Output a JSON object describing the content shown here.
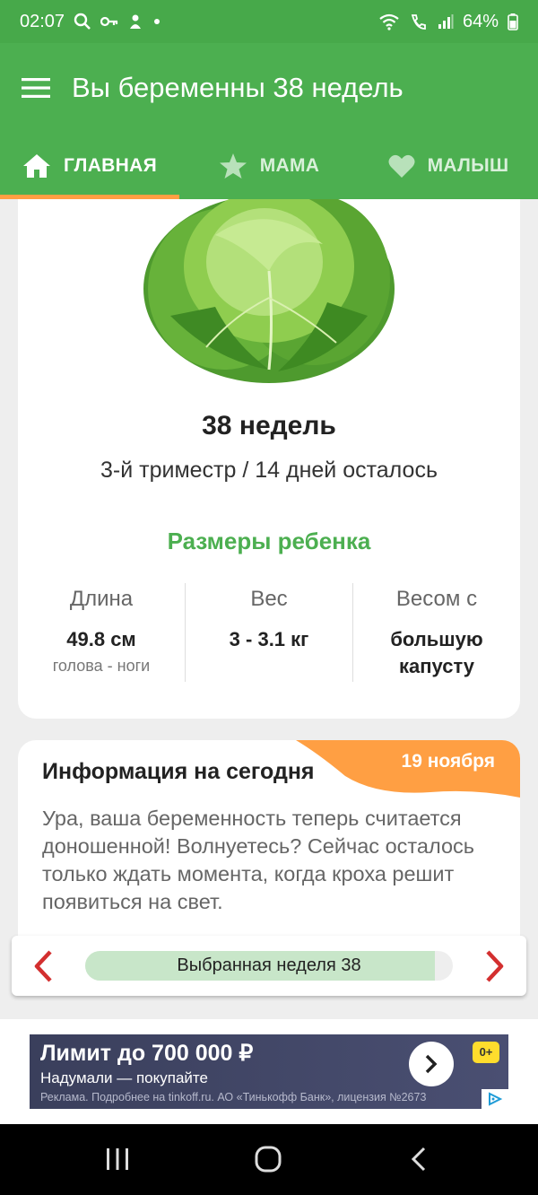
{
  "status": {
    "time": "02:07",
    "battery": "64%"
  },
  "appbar": {
    "title": "Вы беременны 38 недель"
  },
  "tabs": [
    {
      "label": "ГЛАВНАЯ",
      "icon": "home-icon",
      "active": true
    },
    {
      "label": "МАМА",
      "icon": "star-icon",
      "active": false
    },
    {
      "label": "МАЛЫШ",
      "icon": "heart-icon",
      "active": false
    }
  ],
  "summary": {
    "week_title": "38 недель",
    "subtitle": "3-й триместр / 14 дней осталось",
    "image": "cabbage-image",
    "sizes_title": "Размеры ребенка",
    "length": {
      "label": "Длина",
      "value": "49.8 см",
      "note": "голова - ноги"
    },
    "weight": {
      "label": "Вес",
      "value": "3 - 3.1 кг"
    },
    "size_compare": {
      "label": "Весом с",
      "value_line1": "большую",
      "value_line2": "капусту"
    }
  },
  "info": {
    "title": "Информация на сегодня",
    "date": "19 ноября",
    "text": "Ура, ваша беременность теперь считается доношенной! Волнуетесь? Сейчас осталось только ждать момента, когда кроха решит появиться на свет."
  },
  "week_nav": {
    "label": "Выбранная неделя 38",
    "progress": 0.95
  },
  "ad": {
    "headline": "Лимит до 700 000 ₽",
    "subline": "Надумали — покупайте",
    "legal": "Реклама. Подробнее на tinkoff.ru. АО «Тинькофф Банк», лицензия №2673",
    "age": "0+"
  },
  "colors": {
    "primary": "#4caf50",
    "accent": "#ff9f43",
    "arrow": "#d32f2f"
  }
}
